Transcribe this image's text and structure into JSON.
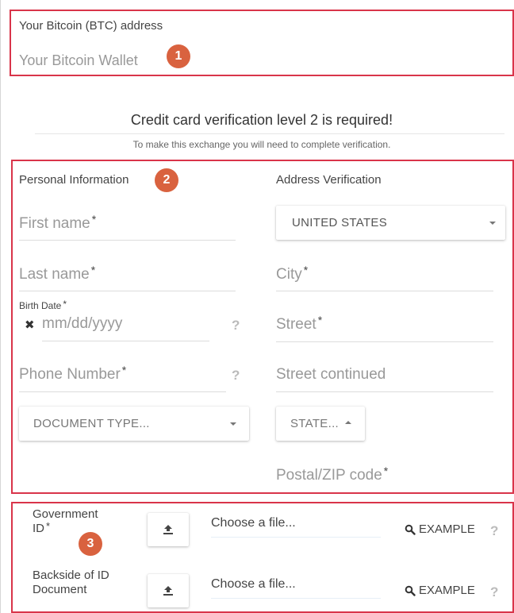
{
  "wallet": {
    "label": "Your Bitcoin (BTC) address",
    "placeholder": "Your Bitcoin Wallet",
    "badge": "1"
  },
  "notice": {
    "title": "Credit card verification level 2 is required!",
    "subtitle": "To make this exchange you will need to complete verification."
  },
  "personal": {
    "heading": "Personal Information",
    "badge": "2",
    "first_name": "First name",
    "last_name": "Last name",
    "birth_label": "Birth Date",
    "birth_placeholder": "mm/dd/yyyy",
    "clear_glyph": "✖",
    "phone": "Phone Number",
    "document_type": "DOCUMENT TYPE...",
    "required_mark": "*",
    "help_glyph": "?"
  },
  "address": {
    "heading": "Address Verification",
    "country": "UNITED STATES",
    "city": "City",
    "street": "Street",
    "street_continued": "Street continued",
    "state": "STATE...",
    "postal": "Postal/ZIP code"
  },
  "documents": {
    "badge": "3",
    "gov_id_label_line1": "Government",
    "gov_id_label_line2": "ID",
    "backside_label_line1": "Backside of ID",
    "backside_label_line2": "Document",
    "choose_file": "Choose a file...",
    "example": "EXAMPLE"
  },
  "colors": {
    "callout_border": "#d9344a",
    "badge": "#d9623f",
    "placeholder_text": "#999999"
  }
}
